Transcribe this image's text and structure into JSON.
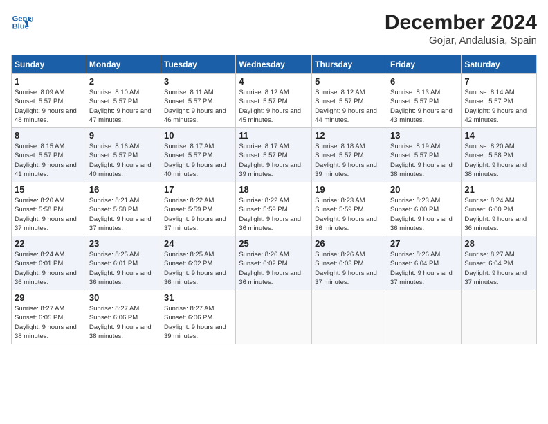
{
  "header": {
    "logo_line1": "General",
    "logo_line2": "Blue",
    "title": "December 2024",
    "subtitle": "Gojar, Andalusia, Spain"
  },
  "columns": [
    "Sunday",
    "Monday",
    "Tuesday",
    "Wednesday",
    "Thursday",
    "Friday",
    "Saturday"
  ],
  "rows": [
    [
      {
        "day": "1",
        "sunrise": "Sunrise: 8:09 AM",
        "sunset": "Sunset: 5:57 PM",
        "daylight": "Daylight: 9 hours and 48 minutes."
      },
      {
        "day": "2",
        "sunrise": "Sunrise: 8:10 AM",
        "sunset": "Sunset: 5:57 PM",
        "daylight": "Daylight: 9 hours and 47 minutes."
      },
      {
        "day": "3",
        "sunrise": "Sunrise: 8:11 AM",
        "sunset": "Sunset: 5:57 PM",
        "daylight": "Daylight: 9 hours and 46 minutes."
      },
      {
        "day": "4",
        "sunrise": "Sunrise: 8:12 AM",
        "sunset": "Sunset: 5:57 PM",
        "daylight": "Daylight: 9 hours and 45 minutes."
      },
      {
        "day": "5",
        "sunrise": "Sunrise: 8:12 AM",
        "sunset": "Sunset: 5:57 PM",
        "daylight": "Daylight: 9 hours and 44 minutes."
      },
      {
        "day": "6",
        "sunrise": "Sunrise: 8:13 AM",
        "sunset": "Sunset: 5:57 PM",
        "daylight": "Daylight: 9 hours and 43 minutes."
      },
      {
        "day": "7",
        "sunrise": "Sunrise: 8:14 AM",
        "sunset": "Sunset: 5:57 PM",
        "daylight": "Daylight: 9 hours and 42 minutes."
      }
    ],
    [
      {
        "day": "8",
        "sunrise": "Sunrise: 8:15 AM",
        "sunset": "Sunset: 5:57 PM",
        "daylight": "Daylight: 9 hours and 41 minutes."
      },
      {
        "day": "9",
        "sunrise": "Sunrise: 8:16 AM",
        "sunset": "Sunset: 5:57 PM",
        "daylight": "Daylight: 9 hours and 40 minutes."
      },
      {
        "day": "10",
        "sunrise": "Sunrise: 8:17 AM",
        "sunset": "Sunset: 5:57 PM",
        "daylight": "Daylight: 9 hours and 40 minutes."
      },
      {
        "day": "11",
        "sunrise": "Sunrise: 8:17 AM",
        "sunset": "Sunset: 5:57 PM",
        "daylight": "Daylight: 9 hours and 39 minutes."
      },
      {
        "day": "12",
        "sunrise": "Sunrise: 8:18 AM",
        "sunset": "Sunset: 5:57 PM",
        "daylight": "Daylight: 9 hours and 39 minutes."
      },
      {
        "day": "13",
        "sunrise": "Sunrise: 8:19 AM",
        "sunset": "Sunset: 5:57 PM",
        "daylight": "Daylight: 9 hours and 38 minutes."
      },
      {
        "day": "14",
        "sunrise": "Sunrise: 8:20 AM",
        "sunset": "Sunset: 5:58 PM",
        "daylight": "Daylight: 9 hours and 38 minutes."
      }
    ],
    [
      {
        "day": "15",
        "sunrise": "Sunrise: 8:20 AM",
        "sunset": "Sunset: 5:58 PM",
        "daylight": "Daylight: 9 hours and 37 minutes."
      },
      {
        "day": "16",
        "sunrise": "Sunrise: 8:21 AM",
        "sunset": "Sunset: 5:58 PM",
        "daylight": "Daylight: 9 hours and 37 minutes."
      },
      {
        "day": "17",
        "sunrise": "Sunrise: 8:22 AM",
        "sunset": "Sunset: 5:59 PM",
        "daylight": "Daylight: 9 hours and 37 minutes."
      },
      {
        "day": "18",
        "sunrise": "Sunrise: 8:22 AM",
        "sunset": "Sunset: 5:59 PM",
        "daylight": "Daylight: 9 hours and 36 minutes."
      },
      {
        "day": "19",
        "sunrise": "Sunrise: 8:23 AM",
        "sunset": "Sunset: 5:59 PM",
        "daylight": "Daylight: 9 hours and 36 minutes."
      },
      {
        "day": "20",
        "sunrise": "Sunrise: 8:23 AM",
        "sunset": "Sunset: 6:00 PM",
        "daylight": "Daylight: 9 hours and 36 minutes."
      },
      {
        "day": "21",
        "sunrise": "Sunrise: 8:24 AM",
        "sunset": "Sunset: 6:00 PM",
        "daylight": "Daylight: 9 hours and 36 minutes."
      }
    ],
    [
      {
        "day": "22",
        "sunrise": "Sunrise: 8:24 AM",
        "sunset": "Sunset: 6:01 PM",
        "daylight": "Daylight: 9 hours and 36 minutes."
      },
      {
        "day": "23",
        "sunrise": "Sunrise: 8:25 AM",
        "sunset": "Sunset: 6:01 PM",
        "daylight": "Daylight: 9 hours and 36 minutes."
      },
      {
        "day": "24",
        "sunrise": "Sunrise: 8:25 AM",
        "sunset": "Sunset: 6:02 PM",
        "daylight": "Daylight: 9 hours and 36 minutes."
      },
      {
        "day": "25",
        "sunrise": "Sunrise: 8:26 AM",
        "sunset": "Sunset: 6:02 PM",
        "daylight": "Daylight: 9 hours and 36 minutes."
      },
      {
        "day": "26",
        "sunrise": "Sunrise: 8:26 AM",
        "sunset": "Sunset: 6:03 PM",
        "daylight": "Daylight: 9 hours and 37 minutes."
      },
      {
        "day": "27",
        "sunrise": "Sunrise: 8:26 AM",
        "sunset": "Sunset: 6:04 PM",
        "daylight": "Daylight: 9 hours and 37 minutes."
      },
      {
        "day": "28",
        "sunrise": "Sunrise: 8:27 AM",
        "sunset": "Sunset: 6:04 PM",
        "daylight": "Daylight: 9 hours and 37 minutes."
      }
    ],
    [
      {
        "day": "29",
        "sunrise": "Sunrise: 8:27 AM",
        "sunset": "Sunset: 6:05 PM",
        "daylight": "Daylight: 9 hours and 38 minutes."
      },
      {
        "day": "30",
        "sunrise": "Sunrise: 8:27 AM",
        "sunset": "Sunset: 6:06 PM",
        "daylight": "Daylight: 9 hours and 38 minutes."
      },
      {
        "day": "31",
        "sunrise": "Sunrise: 8:27 AM",
        "sunset": "Sunset: 6:06 PM",
        "daylight": "Daylight: 9 hours and 39 minutes."
      },
      null,
      null,
      null,
      null
    ]
  ]
}
